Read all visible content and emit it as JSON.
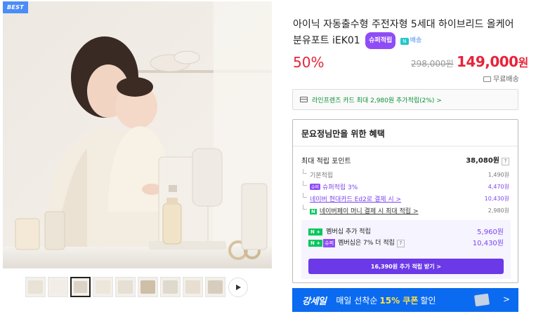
{
  "badge": "BEST",
  "product": {
    "title": "아이닉 자동출수형 주전자형 5세대 하이브리드 올케어 분유포트 iEK01",
    "super_badge": "슈퍼적립",
    "ship_badge": "배송",
    "discount": "50%",
    "original_price": "298,000원",
    "sale_price": "149,000",
    "won": "원",
    "shipping": "무료배송"
  },
  "card_benefit": "라인프렌즈 카드 최대 2,980원 추가적립(2%) >",
  "benefit": {
    "title": "문요정님만을 위한 혜택",
    "max_label": "최대 적립 포인트",
    "max_value": "38,080원",
    "rows": [
      {
        "label": "기본적립",
        "value": "1,490원"
      },
      {
        "tag": "슈퍼",
        "label": "슈퍼적립 3%",
        "value": "4,470원"
      },
      {
        "label": "네이버 현대카드 Ed2로 결제 시 >",
        "value": "10,430원"
      },
      {
        "tag": "N",
        "label": "네이버페이 머니 결제 시 최대 적립 >",
        "value": "2,980원"
      }
    ],
    "member": {
      "row1_label": "멤버십 추가 적립",
      "row1_value": "5,960원",
      "row2_label": "멤버십은 7% 더 적립",
      "row2_value": "10,430원",
      "np_tag": "N +",
      "super_tag": "슈퍼",
      "button": "16,390원 추가 적립 받기 >"
    }
  },
  "banner": {
    "logo": "강세일",
    "text_pre": "매일 선착순",
    "highlight": "15% 쿠폰",
    "text_post": "할인",
    "arrow": ">"
  },
  "thumbnails_count": 9,
  "colors": {
    "price_red": "#e8233a",
    "naver_green": "#03c75a",
    "super_purple": "#8f4cf6",
    "banner_blue": "#0b6bf0"
  }
}
